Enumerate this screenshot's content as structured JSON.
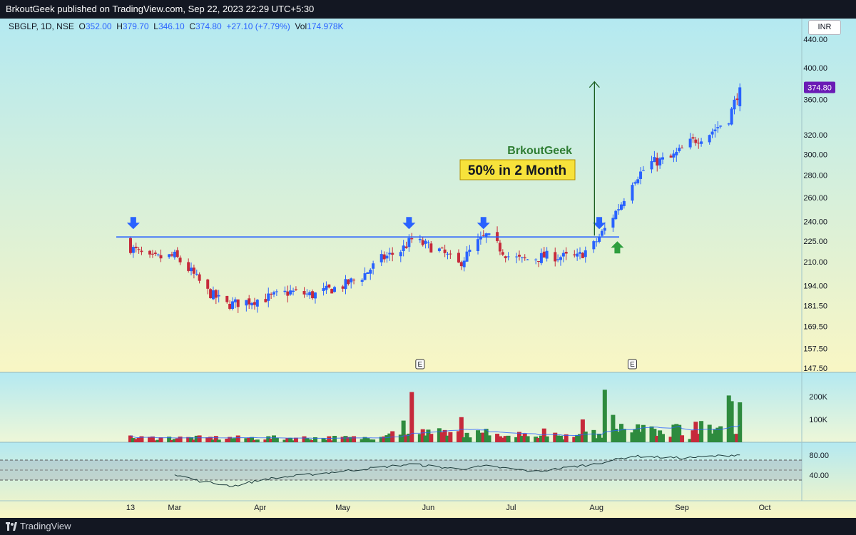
{
  "header": {
    "publish_line": "BrkoutGeek published on TradingView.com, Sep 22, 2023 22:29 UTC+5:30"
  },
  "legend": {
    "symbol": "SBGLP, 1D, NSE",
    "open_label": "O",
    "open": "352.00",
    "high_label": "H",
    "high": "379.70",
    "low_label": "L",
    "low": "346.10",
    "close_label": "C",
    "close": "374.80",
    "change": "+27.10 (+7.79%)",
    "vol_label": "Vol",
    "vol": "174.978K"
  },
  "currency_button": "INR",
  "annotations": {
    "author": "BrkoutGeek",
    "callout": "50% in 2 Month",
    "earnings_marker": "E"
  },
  "colors": {
    "bg_top": "#b4e9f1",
    "bg_bottom": "#f9f6c4",
    "up": "#2962ff",
    "down": "#c62a3b",
    "vol_up": "#2e8b3e",
    "vol_down": "#c62a3b",
    "resistance": "#2962ff",
    "callout_bg": "#f7e23b",
    "author_text": "#2e7d32",
    "price_tag": "#6a1bb5"
  },
  "footer": {
    "brand": "TradingView"
  },
  "chart_data": [
    {
      "type": "candlestick",
      "title": "SBGLP, 1D, NSE",
      "ylim": [
        147.5,
        460
      ],
      "log_scale": true,
      "y_ticks": [
        "440.00",
        "400.00",
        "360.00",
        "320.00",
        "300.00",
        "280.00",
        "260.00",
        "240.00",
        "225.00",
        "210.00",
        "194.00",
        "181.50",
        "169.50",
        "157.50",
        "147.50"
      ],
      "y_tick_values": [
        440,
        400,
        360,
        320,
        300,
        280,
        260,
        240,
        225,
        210,
        194,
        181.5,
        169.5,
        157.5,
        147.5
      ],
      "x_ticks": [
        "13",
        "Mar",
        "Apr",
        "May",
        "Jun",
        "Jul",
        "Aug",
        "Sep",
        "Oct"
      ],
      "x_tick_dates": [
        "2023-02-13",
        "2023-03-01",
        "2023-04-01",
        "2023-05-01",
        "2023-06-01",
        "2023-07-01",
        "2023-08-01",
        "2023-09-01",
        "2023-10-01"
      ],
      "last_price_label": "374.80",
      "resistance_level": 228,
      "grid": false,
      "anchors": [
        {
          "date": "2023-02-13",
          "close": 220
        },
        {
          "date": "2023-02-20",
          "close": 212
        },
        {
          "date": "2023-03-01",
          "close": 214
        },
        {
          "date": "2023-03-07",
          "close": 203
        },
        {
          "date": "2023-03-13",
          "close": 190
        },
        {
          "date": "2023-03-20",
          "close": 182
        },
        {
          "date": "2023-03-27",
          "close": 184
        },
        {
          "date": "2023-04-03",
          "close": 186
        },
        {
          "date": "2023-04-12",
          "close": 190
        },
        {
          "date": "2023-04-20",
          "close": 188
        },
        {
          "date": "2023-05-01",
          "close": 194
        },
        {
          "date": "2023-05-08",
          "close": 200
        },
        {
          "date": "2023-05-15",
          "close": 212
        },
        {
          "date": "2023-05-22",
          "close": 218
        },
        {
          "date": "2023-05-26",
          "close": 226
        },
        {
          "date": "2023-06-05",
          "close": 218
        },
        {
          "date": "2023-06-12",
          "close": 208
        },
        {
          "date": "2023-06-19",
          "close": 224
        },
        {
          "date": "2023-06-22",
          "close": 229
        },
        {
          "date": "2023-06-30",
          "close": 214
        },
        {
          "date": "2023-07-05",
          "close": 211
        },
        {
          "date": "2023-07-14",
          "close": 214
        },
        {
          "date": "2023-07-25",
          "close": 213
        },
        {
          "date": "2023-07-31",
          "close": 222
        },
        {
          "date": "2023-08-04",
          "close": 234
        },
        {
          "date": "2023-08-10",
          "close": 255
        },
        {
          "date": "2023-08-14",
          "close": 275
        },
        {
          "date": "2023-08-21",
          "close": 292
        },
        {
          "date": "2023-08-28",
          "close": 296
        },
        {
          "date": "2023-09-04",
          "close": 312
        },
        {
          "date": "2023-09-11",
          "close": 322
        },
        {
          "date": "2023-09-18",
          "close": 338
        },
        {
          "date": "2023-09-22",
          "close": 374.8
        }
      ],
      "markers": {
        "down_arrows": [
          "2023-02-14",
          "2023-05-25",
          "2023-06-21",
          "2023-08-02"
        ],
        "up_arrow": "2023-08-07",
        "earnings": [
          "2023-05-29",
          "2023-08-14"
        ],
        "target_arrow": {
          "date": "2023-07-31",
          "from": 228,
          "to": 380
        }
      }
    },
    {
      "type": "bar",
      "title": "Volume",
      "y_ticks": [
        "200K",
        "100K"
      ],
      "y_tick_values": [
        200000,
        100000
      ],
      "ylim": [
        0,
        250000
      ],
      "spikes": [
        {
          "date": "2023-05-26",
          "value": 220000
        },
        {
          "date": "2023-05-23",
          "value": 95000
        },
        {
          "date": "2023-06-13",
          "value": 110000
        },
        {
          "date": "2023-07-27",
          "value": 100000
        },
        {
          "date": "2023-08-04",
          "value": 230000
        },
        {
          "date": "2023-08-07",
          "value": 120000
        },
        {
          "date": "2023-09-06",
          "value": 90000
        },
        {
          "date": "2023-09-18",
          "value": 205000
        },
        {
          "date": "2023-09-19",
          "value": 180000
        },
        {
          "date": "2023-09-22",
          "value": 174978
        }
      ]
    },
    {
      "type": "line",
      "title": "RSI",
      "y_ticks": [
        "80.00",
        "40.00"
      ],
      "y_tick_values": [
        80,
        40
      ],
      "band": [
        30,
        70
      ],
      "anchors": [
        {
          "date": "2023-03-01",
          "value": 42
        },
        {
          "date": "2023-03-10",
          "value": 28
        },
        {
          "date": "2023-03-22",
          "value": 18
        },
        {
          "date": "2023-04-03",
          "value": 32
        },
        {
          "date": "2023-05-01",
          "value": 48
        },
        {
          "date": "2023-05-26",
          "value": 62
        },
        {
          "date": "2023-06-12",
          "value": 52
        },
        {
          "date": "2023-06-22",
          "value": 58
        },
        {
          "date": "2023-07-10",
          "value": 47
        },
        {
          "date": "2023-07-31",
          "value": 62
        },
        {
          "date": "2023-08-14",
          "value": 78
        },
        {
          "date": "2023-09-01",
          "value": 74
        },
        {
          "date": "2023-09-22",
          "value": 81
        }
      ]
    }
  ]
}
